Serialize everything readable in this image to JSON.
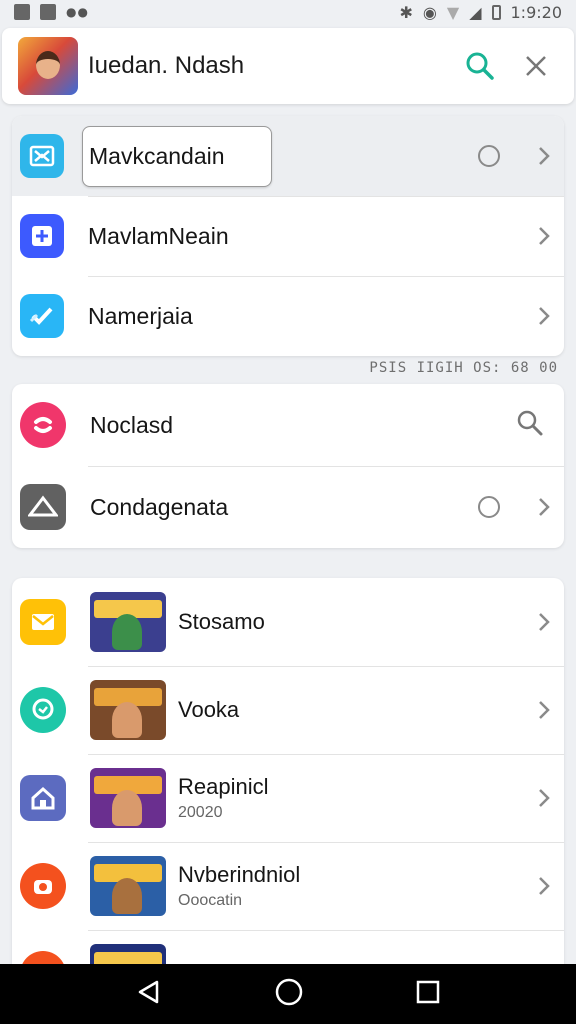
{
  "status": {
    "time": "1:9:20"
  },
  "search": {
    "query": "Iuedan. Ndash"
  },
  "settings_group": [
    {
      "label": "Mavkcandain",
      "icon": "grid-icon",
      "color": "#2fb6ea",
      "has_radio": true
    },
    {
      "label": "MavlamNeain",
      "icon": "plus-square-icon",
      "color": "#3d5afe",
      "has_radio": false
    },
    {
      "label": "Namerjaia",
      "icon": "check-icon",
      "color": "#29b6f6",
      "has_radio": false
    }
  ],
  "caption": "PSIS IIGIH OS: 68 00",
  "secondary_group": [
    {
      "label": "Noclasd",
      "icon": "messenger-icon",
      "color": "#f0366b",
      "trailing": "search"
    },
    {
      "label": "Condagenata",
      "icon": "triangle-icon",
      "color": "#616161",
      "trailing": "radio"
    }
  ],
  "games": [
    {
      "title": "Stosamo",
      "subtitle": "",
      "icon": "mail-icon",
      "icon_color": "#ffc107",
      "thumb": "game-thumbnail-1",
      "thumb_color": "#3b3f8f"
    },
    {
      "title": "Vooka",
      "subtitle": "",
      "icon": "chat-bubble-icon",
      "icon_color": "#1ec7a8",
      "thumb": "game-thumbnail-2",
      "thumb_color": "#7a4a2a"
    },
    {
      "title": "Reapinicl",
      "subtitle": "20020",
      "icon": "home-icon",
      "icon_color": "#5c6bc0",
      "thumb": "game-thumbnail-3",
      "thumb_color": "#6a2f8f"
    },
    {
      "title": "Nvberindniol",
      "subtitle": "Ooocatin",
      "icon": "camera-icon",
      "icon_color": "#f4511e",
      "thumb": "game-thumbnail-4",
      "thumb_color": "#2b5fa6"
    }
  ],
  "colors": {
    "accent": "#19b394",
    "background": "#eef0f3"
  }
}
